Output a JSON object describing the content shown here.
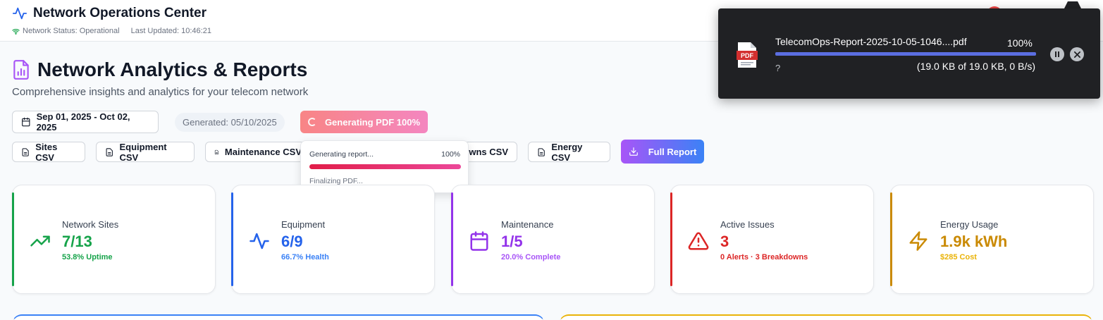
{
  "header": {
    "app_title": "Network Operations Center",
    "network_status": "Network Status: Operational",
    "last_updated": "Last Updated: 10:46:21"
  },
  "page": {
    "title": "Network Analytics & Reports",
    "subtitle": "Comprehensive insights and analytics for your telecom network"
  },
  "toolbar": {
    "date_range": "Sep 01, 2025 - Oct 02, 2025",
    "generated": "Generated: 05/10/2025",
    "generate_pdf_label": "Generating PDF 100%",
    "exports": {
      "sites": "Sites CSV",
      "equipment": "Equipment CSV",
      "maintenance": "Maintenance CSV",
      "breakdowns": "owns CSV",
      "energy": "Energy CSV"
    },
    "full_report": "Full Report"
  },
  "report_progress": {
    "label": "Generating report...",
    "percent_text": "100%",
    "percent": 100,
    "status": "Finalizing PDF..."
  },
  "stats": {
    "sites": {
      "label": "Network Sites",
      "value": "7/13",
      "sub": "53.8% Uptime"
    },
    "equipment": {
      "label": "Equipment",
      "value": "6/9",
      "sub": "66.7% Health"
    },
    "maintenance": {
      "label": "Maintenance",
      "value": "1/5",
      "sub": "20.0% Complete"
    },
    "issues": {
      "label": "Active Issues",
      "value": "3",
      "sub": "0 Alerts · 3 Breakdowns"
    },
    "energy": {
      "label": "Energy Usage",
      "value": "1.9k kWh",
      "sub": "$285 Cost"
    }
  },
  "download": {
    "filename": "TelecomOps-Report-2025-10-05-1046....pdf",
    "percent_text": "100%",
    "percent": 100,
    "unknown": "?",
    "progress_text": "(19.0 KB of 19.0 KB, 0 B/s)",
    "file_icon_label": "PDF"
  },
  "colors": {
    "sites": "#16a34a",
    "equipment": "#2563eb",
    "maintenance": "#9333ea",
    "issues": "#dc2626",
    "energy": "#ca8a04"
  },
  "icons": {
    "app": "activity-icon",
    "status": "wifi-icon",
    "page": "report-icon",
    "date": "calendar-icon",
    "csv": "file-text-icon",
    "full_report": "download-icon",
    "sites": "trending-up-icon",
    "equipment": "activity-icon",
    "maintenance": "calendar-icon",
    "issues": "alert-triangle-icon",
    "energy": "zap-icon"
  }
}
